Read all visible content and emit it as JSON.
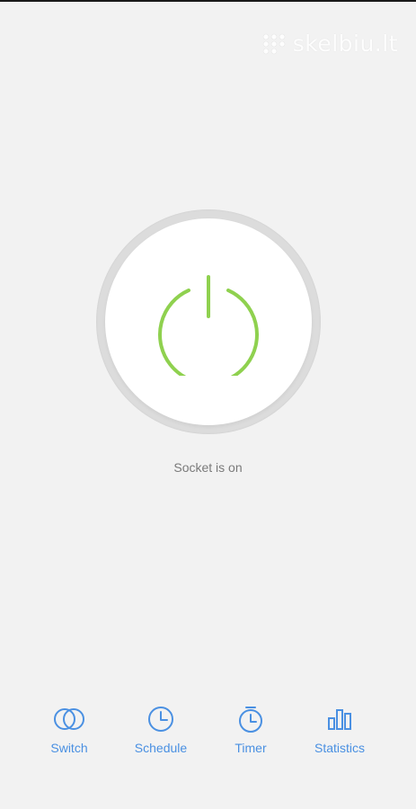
{
  "watermark": {
    "text": "skelbiu.lt"
  },
  "main": {
    "power_state": "on",
    "status_text": "Socket is on",
    "power_color": "#8fd14f"
  },
  "tabs": [
    {
      "label": "Switch",
      "icon": "switch-icon"
    },
    {
      "label": "Schedule",
      "icon": "clock-icon"
    },
    {
      "label": "Timer",
      "icon": "stopwatch-icon"
    },
    {
      "label": "Statistics",
      "icon": "bar-chart-icon"
    }
  ],
  "colors": {
    "background": "#f2f2f2",
    "accent": "#4a90e2",
    "power_on": "#8fd14f"
  }
}
